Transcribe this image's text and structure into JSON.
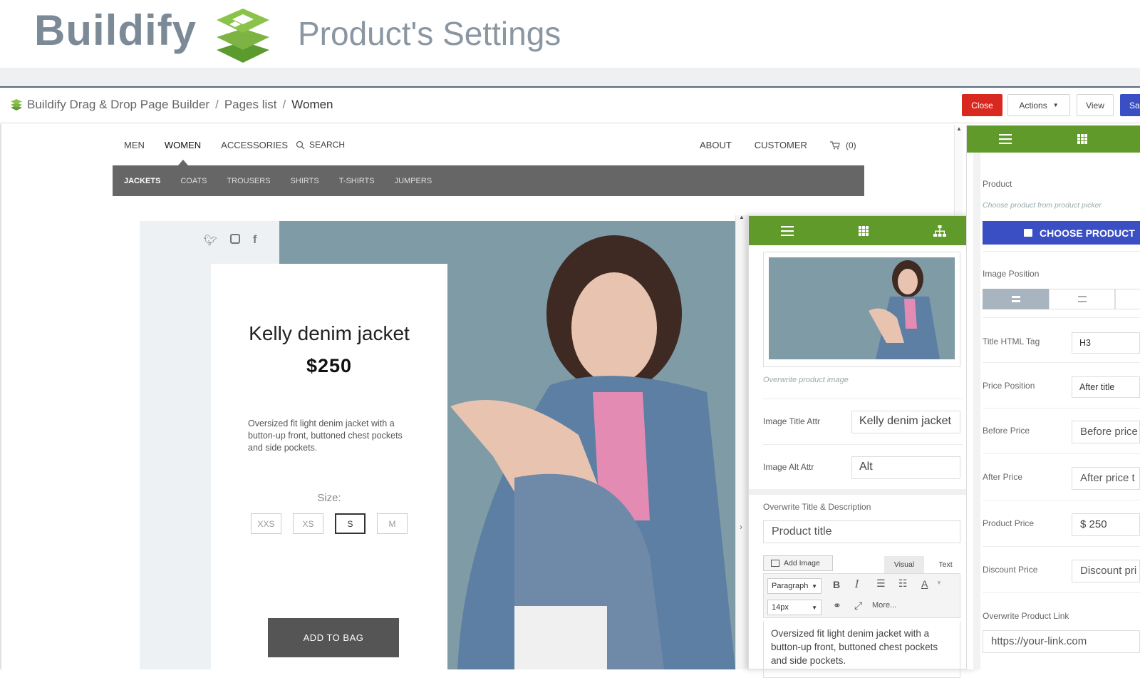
{
  "banner": {
    "brand": "Buildify",
    "title": "Product's Settings"
  },
  "breadcrumb": {
    "root": "Buildify Drag & Drop Page Builder",
    "sep1": "/",
    "pages": "Pages list",
    "sep2": "/",
    "current": "Women"
  },
  "toolbar": {
    "close": "Close",
    "actions": "Actions",
    "view": "View",
    "save": "Sa"
  },
  "site": {
    "nav": [
      "MEN",
      "WOMEN",
      "ACCESSORIES"
    ],
    "search": "SEARCH",
    "nav_right": [
      "ABOUT",
      "CUSTOMER"
    ],
    "cart_count": "(0)",
    "subnav": [
      "JACKETS",
      "COATS",
      "TROUSERS",
      "SHIRTS",
      "T-SHIRTS",
      "JUMPERS"
    ]
  },
  "product": {
    "title": "Kelly denim jacket",
    "price": "$250",
    "description": "Oversized fit light denim jacket with a button-up front, buttoned chest pockets and side pockets.",
    "size_label": "Size:",
    "sizes": [
      "XXS",
      "XS",
      "S",
      "M"
    ],
    "selected_size": "S",
    "add_to_bag": "ADD TO BAG"
  },
  "float_panel": {
    "overwrite_image": "Overwrite product image",
    "image_title_label": "Image Title Attr",
    "image_title_value": "Kelly denim jacket",
    "image_alt_label": "Image Alt Attr",
    "image_alt_value": "Alt",
    "overwrite_title_desc": "Overwrite Title & Description",
    "product_title_placeholder": "Product title",
    "add_image": "Add Image",
    "tab_visual": "Visual",
    "tab_text": "Text",
    "paragraph": "Paragraph",
    "font_size": "14px",
    "more": "More...",
    "editor_text": "Oversized fit light denim jacket with a button-up front, buttoned chest pockets and side pockets."
  },
  "right_panel": {
    "product_label": "Product",
    "product_hint": "Choose product from product picker",
    "choose_product": "CHOOSE PRODUCT",
    "image_position_label": "Image Position",
    "title_tag_label": "Title HTML Tag",
    "title_tag_value": "H3",
    "price_position_label": "Price Position",
    "price_position_value": "After title",
    "before_price_label": "Before Price",
    "before_price_placeholder": "Before price",
    "after_price_label": "After Price",
    "after_price_placeholder": "After price t",
    "product_price_label": "Product Price",
    "product_price_value": "$ 250",
    "discount_price_label": "Discount Price",
    "discount_price_placeholder": "Discount pri",
    "overwrite_link_label": "Overwrite Product Link",
    "link_placeholder": "https://your-link.com"
  },
  "colors": {
    "green": "#5f9a2a",
    "blue": "#3a4fc4",
    "red": "#d9281f",
    "photo_bg": "#7e9ba6"
  }
}
